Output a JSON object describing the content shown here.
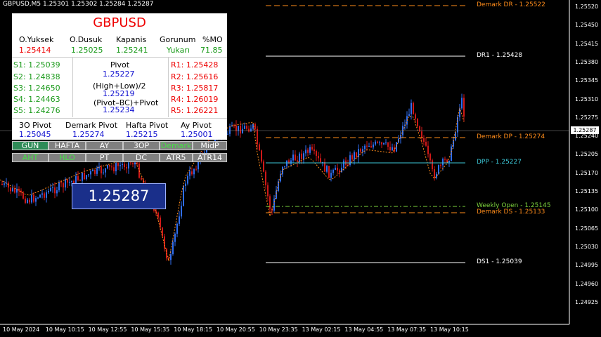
{
  "title_bar": "GBPUSD,M5  1.25301 1.25302 1.25284 1.25287",
  "panel": {
    "pair": "GBPUSD",
    "headers": [
      "O.Yuksek",
      "O.Dusuk",
      "Kapanis",
      "Gorunum",
      "%MO"
    ],
    "values": [
      "1.25414",
      "1.25025",
      "1.25241",
      "Yukarı",
      "71.85"
    ],
    "supports": [
      "S1: 1.25039",
      "S2: 1.24838",
      "S3: 1.24650",
      "S4: 1.24463",
      "S5: 1.24276"
    ],
    "resistances": [
      "R1: 1.25428",
      "R2: 1.25616",
      "R3: 1.25817",
      "R4: 1.26019",
      "R5: 1.26221"
    ],
    "pivot_label": "Pivot",
    "pivot_value": "1.25227",
    "hl_label": "(High+Low)/2",
    "hl_value": "1.25219",
    "bc_label": "(Pivot–BC)+Pivot",
    "bc_value": "1.25234",
    "bottom_labels": [
      "3O Pivot",
      "Demark Pivot",
      "Hafta Pivot",
      "Ay Pivot"
    ],
    "bottom_values": [
      "1.25045",
      "1.25274",
      "1.25215",
      "1.25001"
    ]
  },
  "buttons_row1": [
    "GUN",
    "HAFTA",
    "AY",
    "3OP",
    "Demark",
    "MidP"
  ],
  "buttons_row2": [
    "AHT",
    "HLO",
    "PT",
    "DC",
    "ATR5",
    "ATR14"
  ],
  "price_box": "1.25287",
  "current_price": "1.25287",
  "levels": [
    {
      "label": "Demark DR - 1.25522",
      "price": 1.25522,
      "color": "#ff8c1a",
      "style": "dash"
    },
    {
      "label": "DR1 - 1.25428",
      "price": 1.25428,
      "color": "#ffffff",
      "style": "solid"
    },
    {
      "label": "Demark DP - 1.25274",
      "price": 1.25274,
      "color": "#ff8c1a",
      "style": "dash"
    },
    {
      "label": "DPP - 1.25227",
      "price": 1.25227,
      "color": "#3cc8d8",
      "style": "solid"
    },
    {
      "label": "Weekly Open - 1.25145",
      "price": 1.25145,
      "color": "#7cd23c",
      "style": "dashdot"
    },
    {
      "label": "Demark DS - 1.25133",
      "price": 1.25133,
      "color": "#ff8c1a",
      "style": "dash"
    },
    {
      "label": "DS1 - 1.25039",
      "price": 1.25039,
      "color": "#ffffff",
      "style": "solid"
    }
  ],
  "price_axis": [
    "1.25520",
    "1.25450",
    "1.25415",
    "1.25380",
    "1.25345",
    "1.25310",
    "1.25275",
    "1.25240",
    "1.25205",
    "1.25170",
    "1.25135",
    "1.25100",
    "1.25065",
    "1.25030",
    "1.24995",
    "1.24960",
    "1.24925"
  ],
  "time_axis": [
    "10 May 2024",
    "10 May 10:15",
    "10 May 12:55",
    "10 May 15:35",
    "10 May 18:15",
    "10 May 20:55",
    "10 May 23:35",
    "13 May 02:15",
    "13 May 04:55",
    "13 May 07:35",
    "13 May 10:15"
  ],
  "colors": {
    "bull": "#2f6ef0",
    "bear": "#d01818",
    "background": "#000000"
  }
}
